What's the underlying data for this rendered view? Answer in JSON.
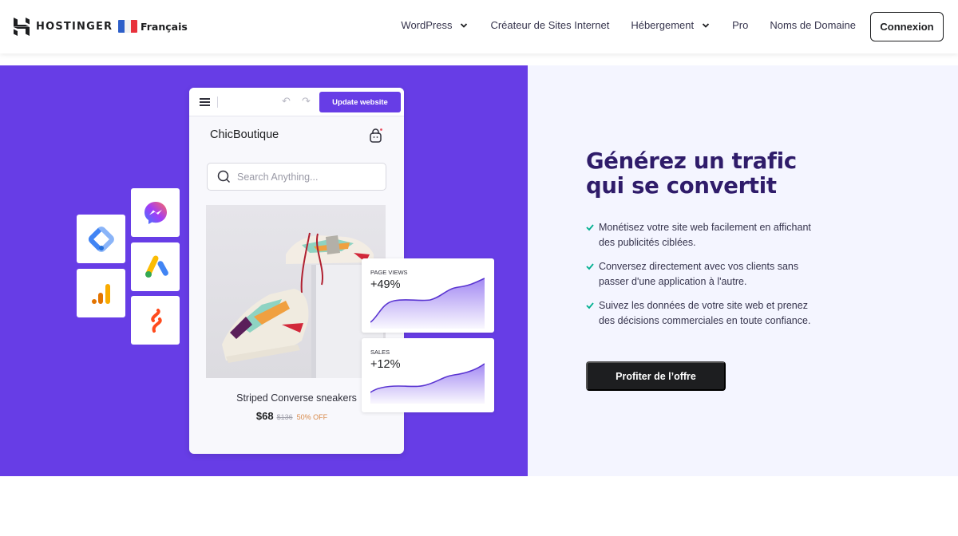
{
  "header": {
    "brand": "HOSTINGER",
    "language": "Français",
    "nav": [
      {
        "label": "WordPress",
        "has_dropdown": true
      },
      {
        "label": "Créateur de Sites Internet",
        "has_dropdown": false
      },
      {
        "label": "Hébergement",
        "has_dropdown": true
      },
      {
        "label": "Pro",
        "has_dropdown": false
      },
      {
        "label": "Noms de Domaine",
        "has_dropdown": false
      }
    ],
    "login_label": "Connexion"
  },
  "mockup": {
    "update_button": "Update website",
    "store_name": "ChicBoutique",
    "search_placeholder": "Search Anything...",
    "product": {
      "name": "Striped Converse sneakers",
      "price": "$68",
      "old_price": "$136",
      "discount": "50% OFF"
    },
    "stats": [
      {
        "label": "PAGE VIEWS",
        "value": "+49%"
      },
      {
        "label": "SALES",
        "value": "+12%"
      }
    ],
    "integrations": [
      "google-tag-manager-icon",
      "messenger-icon",
      "google-analytics-icon",
      "google-ads-icon",
      "zapier-like-icon"
    ]
  },
  "content": {
    "headline_line1": "Générez un trafic",
    "headline_line2": "qui se convertit",
    "features": [
      "Monétisez votre site web facilement en affichant des publicités ciblées.",
      "Conversez directement avec vos clients sans passer d'une application à l'autre.",
      "Suivez les données de votre site web et prenez des décisions commerciales en toute confiance."
    ],
    "cta_label": "Profiter de l’offre"
  },
  "colors": {
    "brand_purple": "#673de6",
    "headline": "#2f1c6a",
    "check_green": "#00b090",
    "dark": "#1d1e20",
    "panel_bg": "#f4f5ff"
  }
}
